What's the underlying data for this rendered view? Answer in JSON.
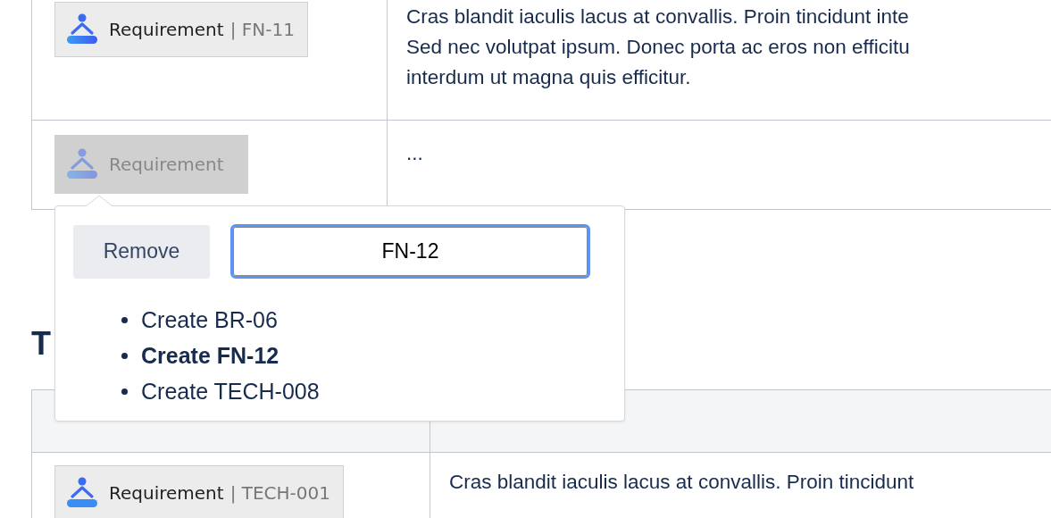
{
  "top_table": {
    "rows": [
      {
        "chip": {
          "label": "Requirement",
          "key": "| FN-11",
          "selected": false
        },
        "description": [
          "Cras blandit iaculis lacus at convallis. Proin tincidunt inte",
          "Sed nec volutpat ipsum. Donec porta ac eros non efficitu",
          "interdum ut magna quis efficitur."
        ]
      },
      {
        "chip": {
          "label": "Requirement",
          "selected": true
        },
        "description": [
          "..."
        ]
      }
    ]
  },
  "heading": "T",
  "bottom_table": {
    "rows": [
      {
        "chip": {
          "label": "Requirement",
          "key": "| TECH-001",
          "selected": false
        },
        "description": [
          "Cras blandit iaculis lacus at convallis. Proin tincidunt"
        ]
      }
    ]
  },
  "popover": {
    "remove_button": "Remove",
    "input": {
      "value": "FN-12"
    },
    "options": [
      {
        "label": "Create BR-06",
        "selected": false
      },
      {
        "label": "Create FN-12",
        "selected": true
      },
      {
        "label": "Create TECH-008",
        "selected": false
      }
    ]
  }
}
